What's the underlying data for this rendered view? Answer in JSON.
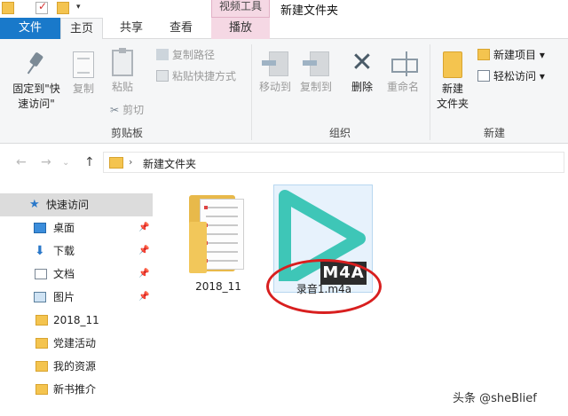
{
  "window": {
    "title": "新建文件夹",
    "context_tab_group": "视频工具"
  },
  "tabs": {
    "file": "文件",
    "home": "主页",
    "share": "共享",
    "view": "查看",
    "play": "播放"
  },
  "ribbon": {
    "clipboard": {
      "pin_quick_access": [
        "固定到\"快",
        "速访问\""
      ],
      "copy": "复制",
      "paste": "粘贴",
      "copy_path": "复制路径",
      "paste_shortcut": "粘贴快捷方式",
      "cut": "剪切",
      "group_label": "剪贴板"
    },
    "organize": {
      "move_to": "移动到",
      "copy_to": "复制到",
      "delete": "删除",
      "rename": "重命名",
      "group_label": "组织"
    },
    "new": {
      "new_folder": [
        "新建",
        "文件夹"
      ],
      "new_item": "新建项目 ▾",
      "easy_access": "轻松访问 ▾",
      "group_label": "新建"
    }
  },
  "address": {
    "path_segment": "新建文件夹",
    "separator": "›",
    "back_icon": "arrow-left",
    "forward_icon": "arrow-right",
    "up_icon": "arrow-up"
  },
  "sidebar": {
    "items": [
      {
        "label": "快速访问",
        "icon": "star",
        "pinned": false
      },
      {
        "label": "桌面",
        "icon": "desktop",
        "pinned": true
      },
      {
        "label": "下载",
        "icon": "download",
        "pinned": true
      },
      {
        "label": "文档",
        "icon": "document",
        "pinned": true
      },
      {
        "label": "图片",
        "icon": "picture",
        "pinned": true
      },
      {
        "label": "2018_11",
        "icon": "folder",
        "pinned": false
      },
      {
        "label": "党建活动",
        "icon": "folder",
        "pinned": false
      },
      {
        "label": "我的资源",
        "icon": "folder",
        "pinned": false
      },
      {
        "label": "新书推介",
        "icon": "folder",
        "pinned": false
      }
    ]
  },
  "files": [
    {
      "name": "2018_11",
      "type": "folder"
    },
    {
      "name": "录音1.m4a",
      "type": "m4a",
      "badge": "M4A",
      "selected": true
    }
  ],
  "annotation": {
    "shape": "red-ellipse",
    "color": "#d81f1f"
  },
  "watermark": "头条 @sheBlief",
  "colors": {
    "file_tab": "#1979ca",
    "context_tab": "#f5d8e4",
    "play_icon": "#3ec6b7",
    "folder": "#f4c44f"
  }
}
